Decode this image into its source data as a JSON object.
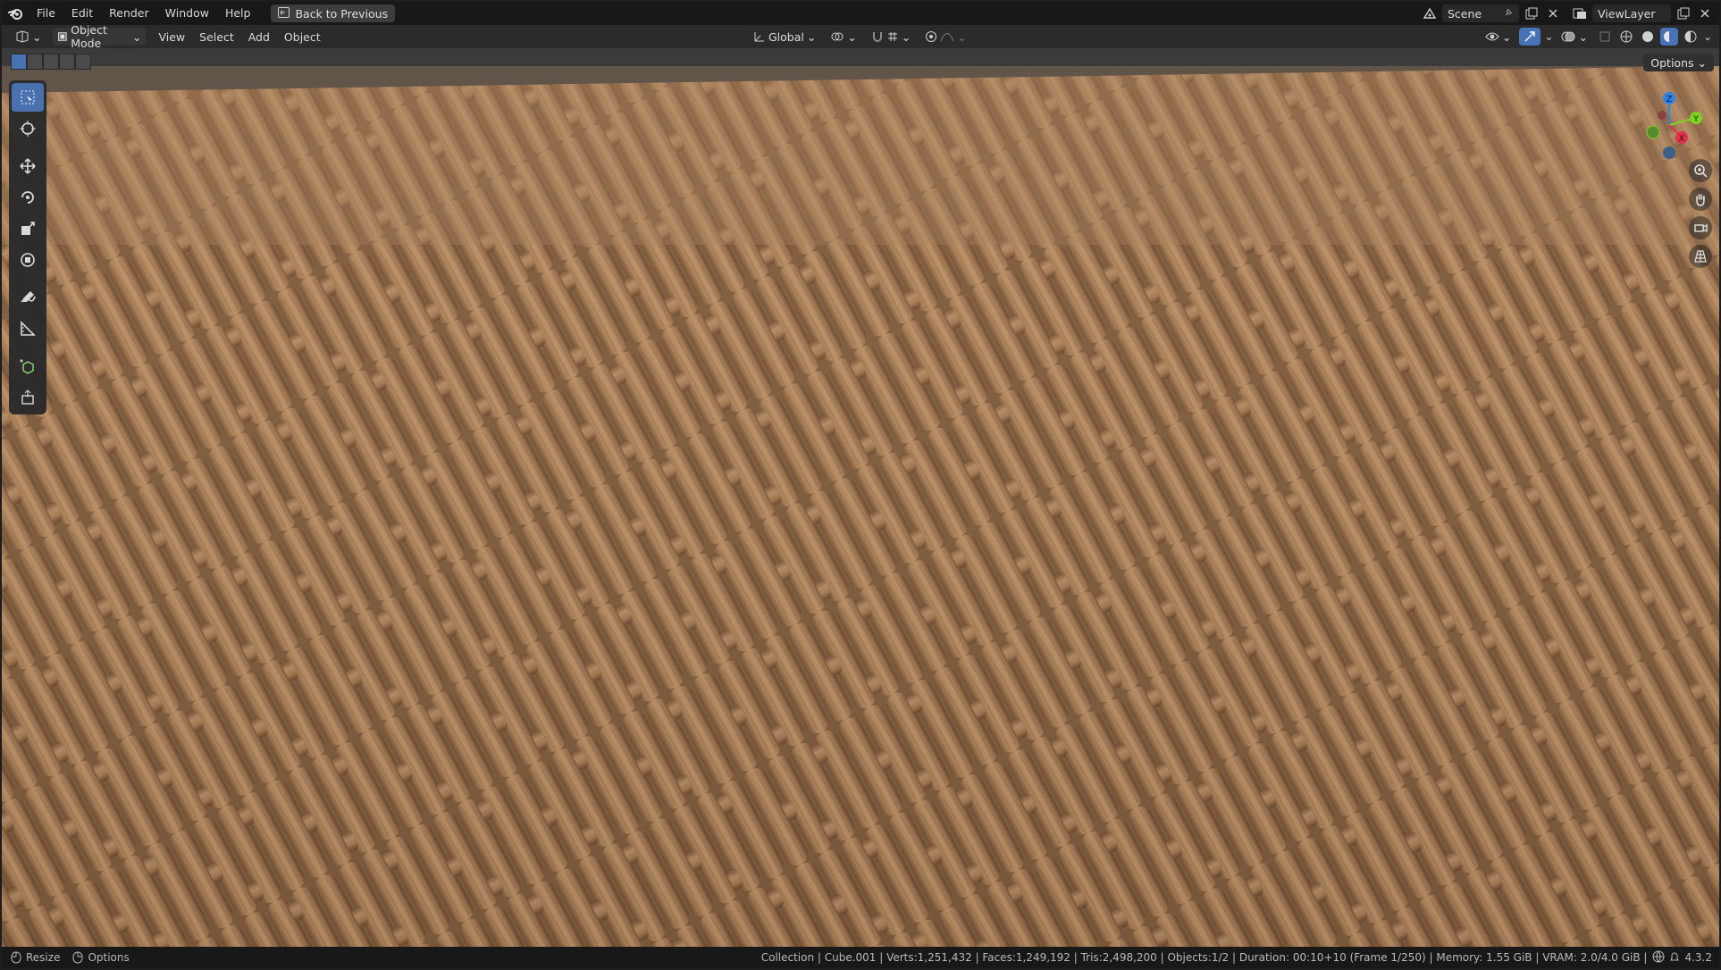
{
  "menu": {
    "items": [
      "File",
      "Edit",
      "Render",
      "Window",
      "Help"
    ],
    "back_button": "Back to Previous"
  },
  "workspace": {
    "scene": "Scene",
    "view_layer": "ViewLayer"
  },
  "header": {
    "mode": "Object Mode",
    "menus": [
      "View",
      "Select",
      "Add",
      "Object"
    ],
    "orientation": "Global"
  },
  "viewport": {
    "options": "Options",
    "gizmo_axes": [
      "Z",
      "Y",
      "X"
    ]
  },
  "status": {
    "left": [
      "Resize",
      "Options"
    ],
    "info": "Collection | Cube.001 | Verts:1,251,432 | Faces:1,249,192 | Tris:2,498,200 | Objects:1/2 | Duration: 00:10+10 (Frame 1/250) | Memory: 1.55 GiB | VRAM: 2.0/4.0 GiB |",
    "version": "4.3.2"
  },
  "colors": {
    "accent": "#4772b3",
    "wood_light": "#b98d64",
    "wood_dark": "#7a5636",
    "axis_x": "#e0314b",
    "axis_y": "#7ed321",
    "axis_z": "#2f83e4"
  }
}
